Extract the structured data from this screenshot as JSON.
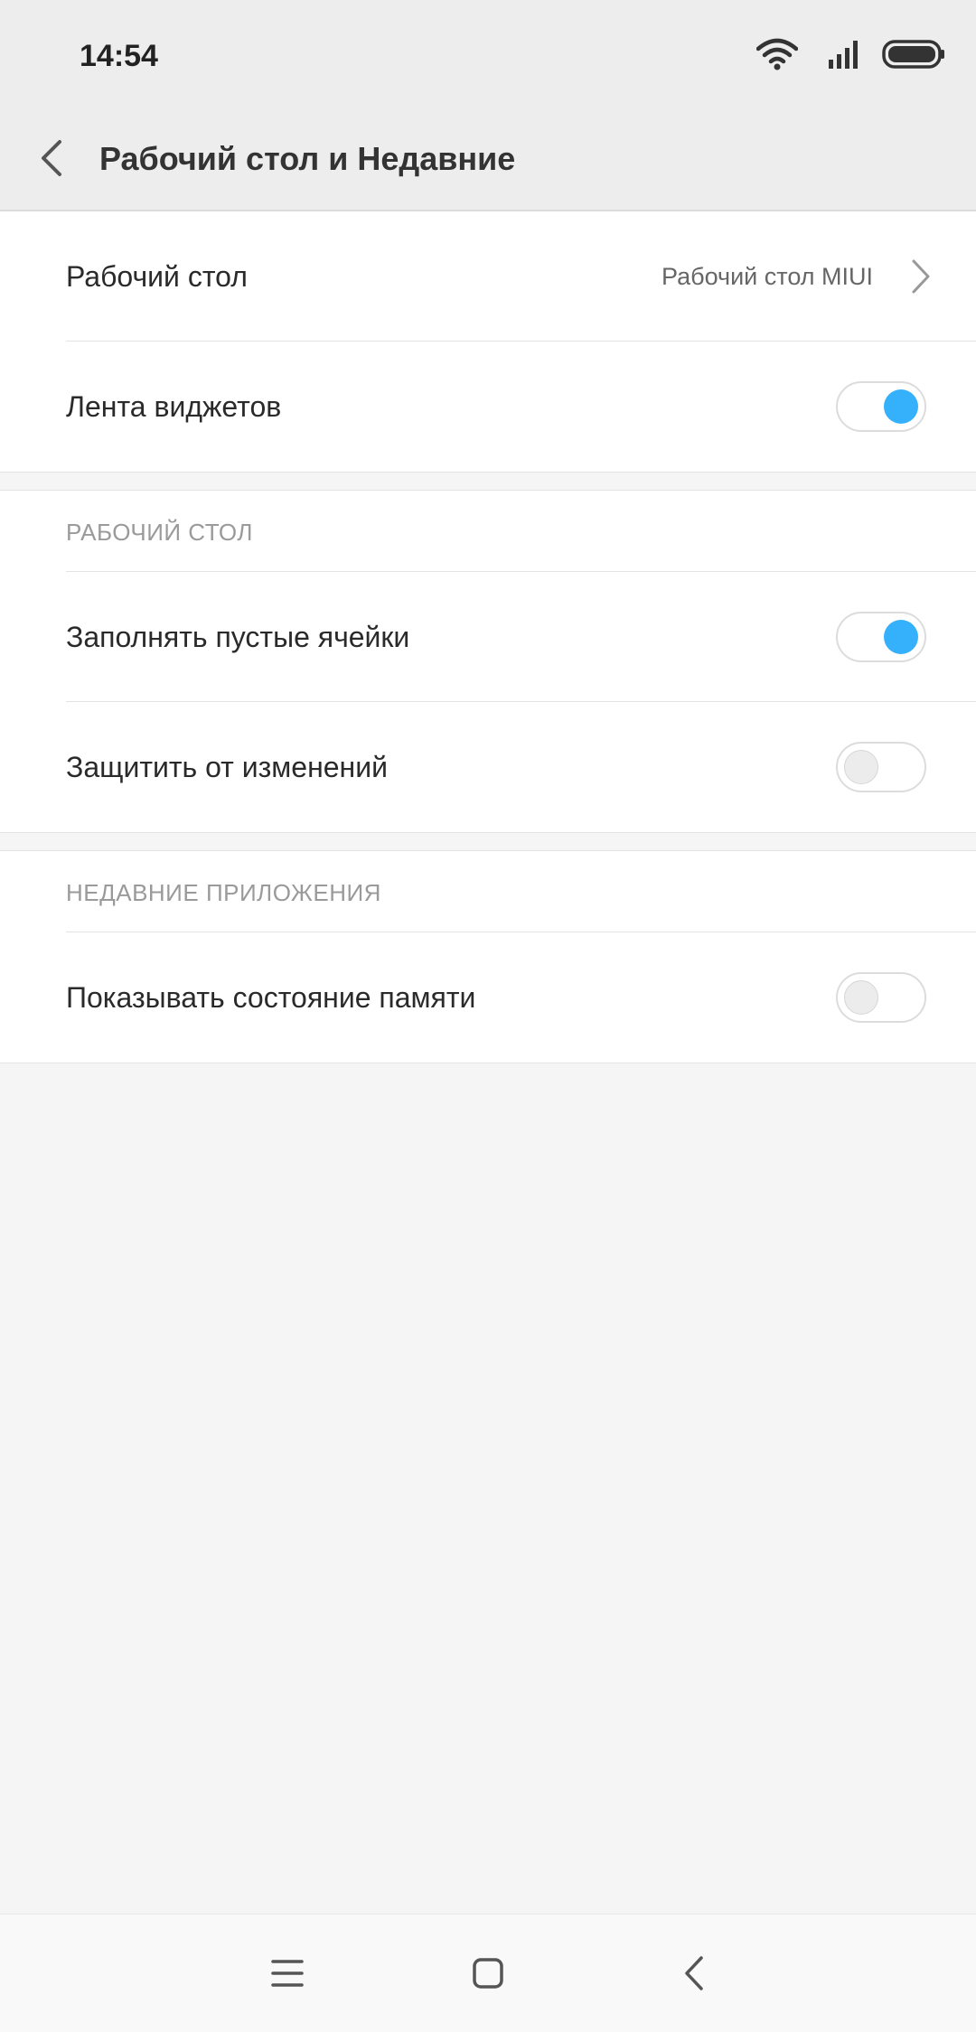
{
  "status_bar": {
    "time": "14:54",
    "icons": [
      "wifi-icon",
      "signal-icon",
      "battery-icon"
    ]
  },
  "header": {
    "title": "Рабочий стол и Недавние",
    "back_icon": "back-arrow-icon"
  },
  "sections": [
    {
      "rows": [
        {
          "label": "Рабочий стол",
          "value": "Рабочий стол MIUI",
          "type": "link"
        },
        {
          "label": "Лента виджетов",
          "type": "toggle",
          "checked": true
        }
      ]
    },
    {
      "header": "РАБОЧИЙ СТОЛ",
      "rows": [
        {
          "label": "Заполнять пустые ячейки",
          "type": "toggle",
          "checked": true
        },
        {
          "label": "Защитить от изменений",
          "type": "toggle",
          "checked": false
        }
      ]
    },
    {
      "header": "НЕДАВНИЕ ПРИЛОЖЕНИЯ",
      "rows": [
        {
          "label": "Показывать состояние памяти",
          "type": "toggle",
          "checked": false
        }
      ]
    }
  ],
  "nav_bar": {
    "buttons": [
      "menu-icon",
      "home-icon",
      "back-icon"
    ]
  },
  "colors": {
    "accent": "#35b0fb",
    "header_bg": "#ededed",
    "page_bg": "#f5f5f5"
  }
}
